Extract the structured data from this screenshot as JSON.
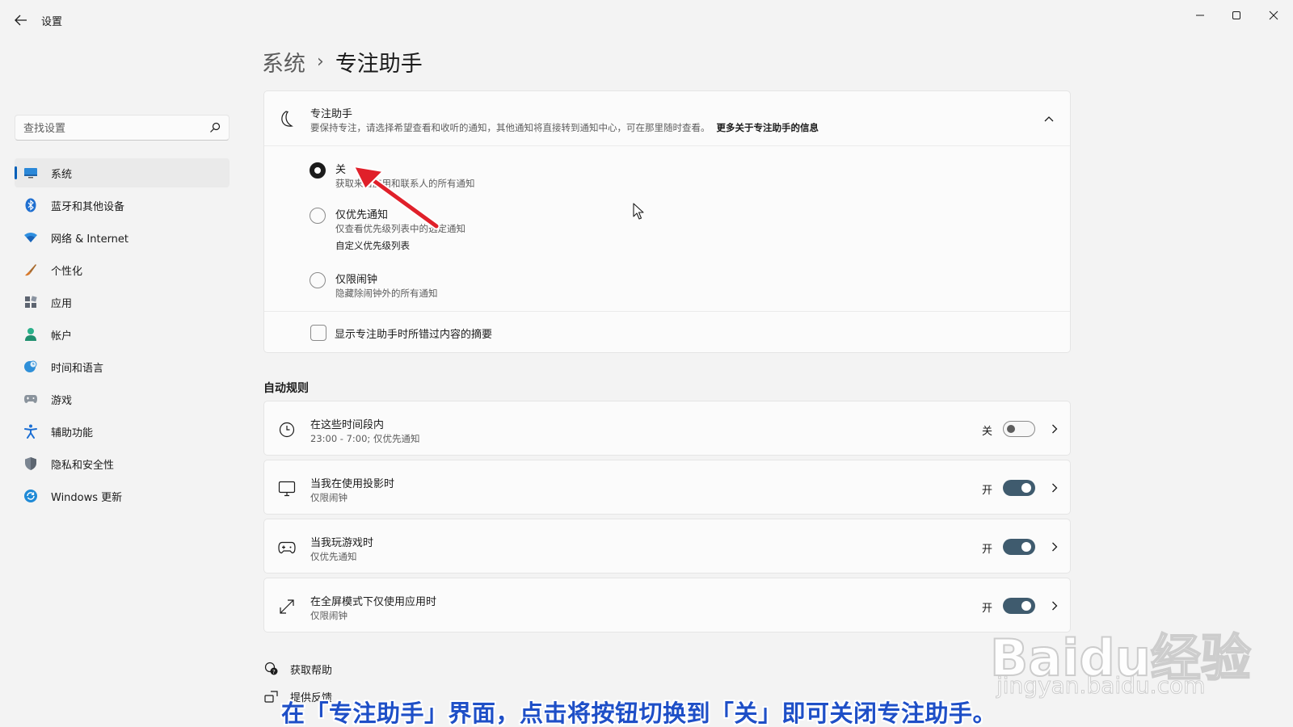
{
  "window": {
    "title": "设置"
  },
  "search": {
    "placeholder": "查找设置"
  },
  "sidebar": {
    "items": [
      {
        "label": "系统",
        "icon": "monitor-icon"
      },
      {
        "label": "蓝牙和其他设备",
        "icon": "bluetooth-icon"
      },
      {
        "label": "网络 & Internet",
        "icon": "wifi-icon"
      },
      {
        "label": "个性化",
        "icon": "brush-icon"
      },
      {
        "label": "应用",
        "icon": "apps-icon"
      },
      {
        "label": "帐户",
        "icon": "account-icon"
      },
      {
        "label": "时间和语言",
        "icon": "globe-clock-icon"
      },
      {
        "label": "游戏",
        "icon": "gamepad-icon"
      },
      {
        "label": "辅助功能",
        "icon": "accessibility-icon"
      },
      {
        "label": "隐私和安全性",
        "icon": "shield-icon"
      },
      {
        "label": "Windows 更新",
        "icon": "update-icon"
      }
    ],
    "active_index": 0
  },
  "breadcrumb": {
    "parent": "系统",
    "separator": "›",
    "current": "专注助手"
  },
  "focus_assist": {
    "title": "专注助手",
    "description": "要保持专注，请选择希望查看和收听的通知，其他通知将直接转到通知中心，可在那里随时查看。",
    "link": "更多关于专注助手的信息",
    "options": [
      {
        "label": "关",
        "description": "获取来自应用和联系人的所有通知",
        "checked": true
      },
      {
        "label": "仅优先通知",
        "description": "仅查看优先级列表中的选定通知",
        "link": "自定义优先级列表",
        "checked": false
      },
      {
        "label": "仅限闹钟",
        "description": "隐藏除闹钟外的所有通知",
        "checked": false
      }
    ],
    "summary_checkbox": {
      "label": "显示专注助手时所错过内容的摘要",
      "checked": false
    }
  },
  "auto_rules": {
    "section_title": "自动规则",
    "rules": [
      {
        "title": "在这些时间段内",
        "subtitle": "23:00 - 7:00; 仅优先通知",
        "state_label": "关",
        "on": false,
        "icon": "clock-icon"
      },
      {
        "title": "当我在使用投影时",
        "subtitle": "仅限闹钟",
        "state_label": "开",
        "on": true,
        "icon": "display-icon"
      },
      {
        "title": "当我玩游戏时",
        "subtitle": "仅优先通知",
        "state_label": "开",
        "on": true,
        "icon": "gamepad-icon"
      },
      {
        "title": "在全屏模式下仅使用应用时",
        "subtitle": "仅限闹钟",
        "state_label": "开",
        "on": true,
        "icon": "fullscreen-icon"
      }
    ]
  },
  "footer": {
    "help": "获取帮助",
    "feedback": "提供反馈"
  },
  "caption": "在「专注助手」界面，点击将按钮切换到「关」即可关闭专注助手。",
  "watermark": {
    "brand": "Baidu经验",
    "url": "jingyan.baidu.com"
  },
  "colors": {
    "accent": "#005fb8",
    "toggle_on": "#3f5b6e",
    "annotation_arrow": "#e0202a",
    "caption": "#1e4fc7"
  }
}
